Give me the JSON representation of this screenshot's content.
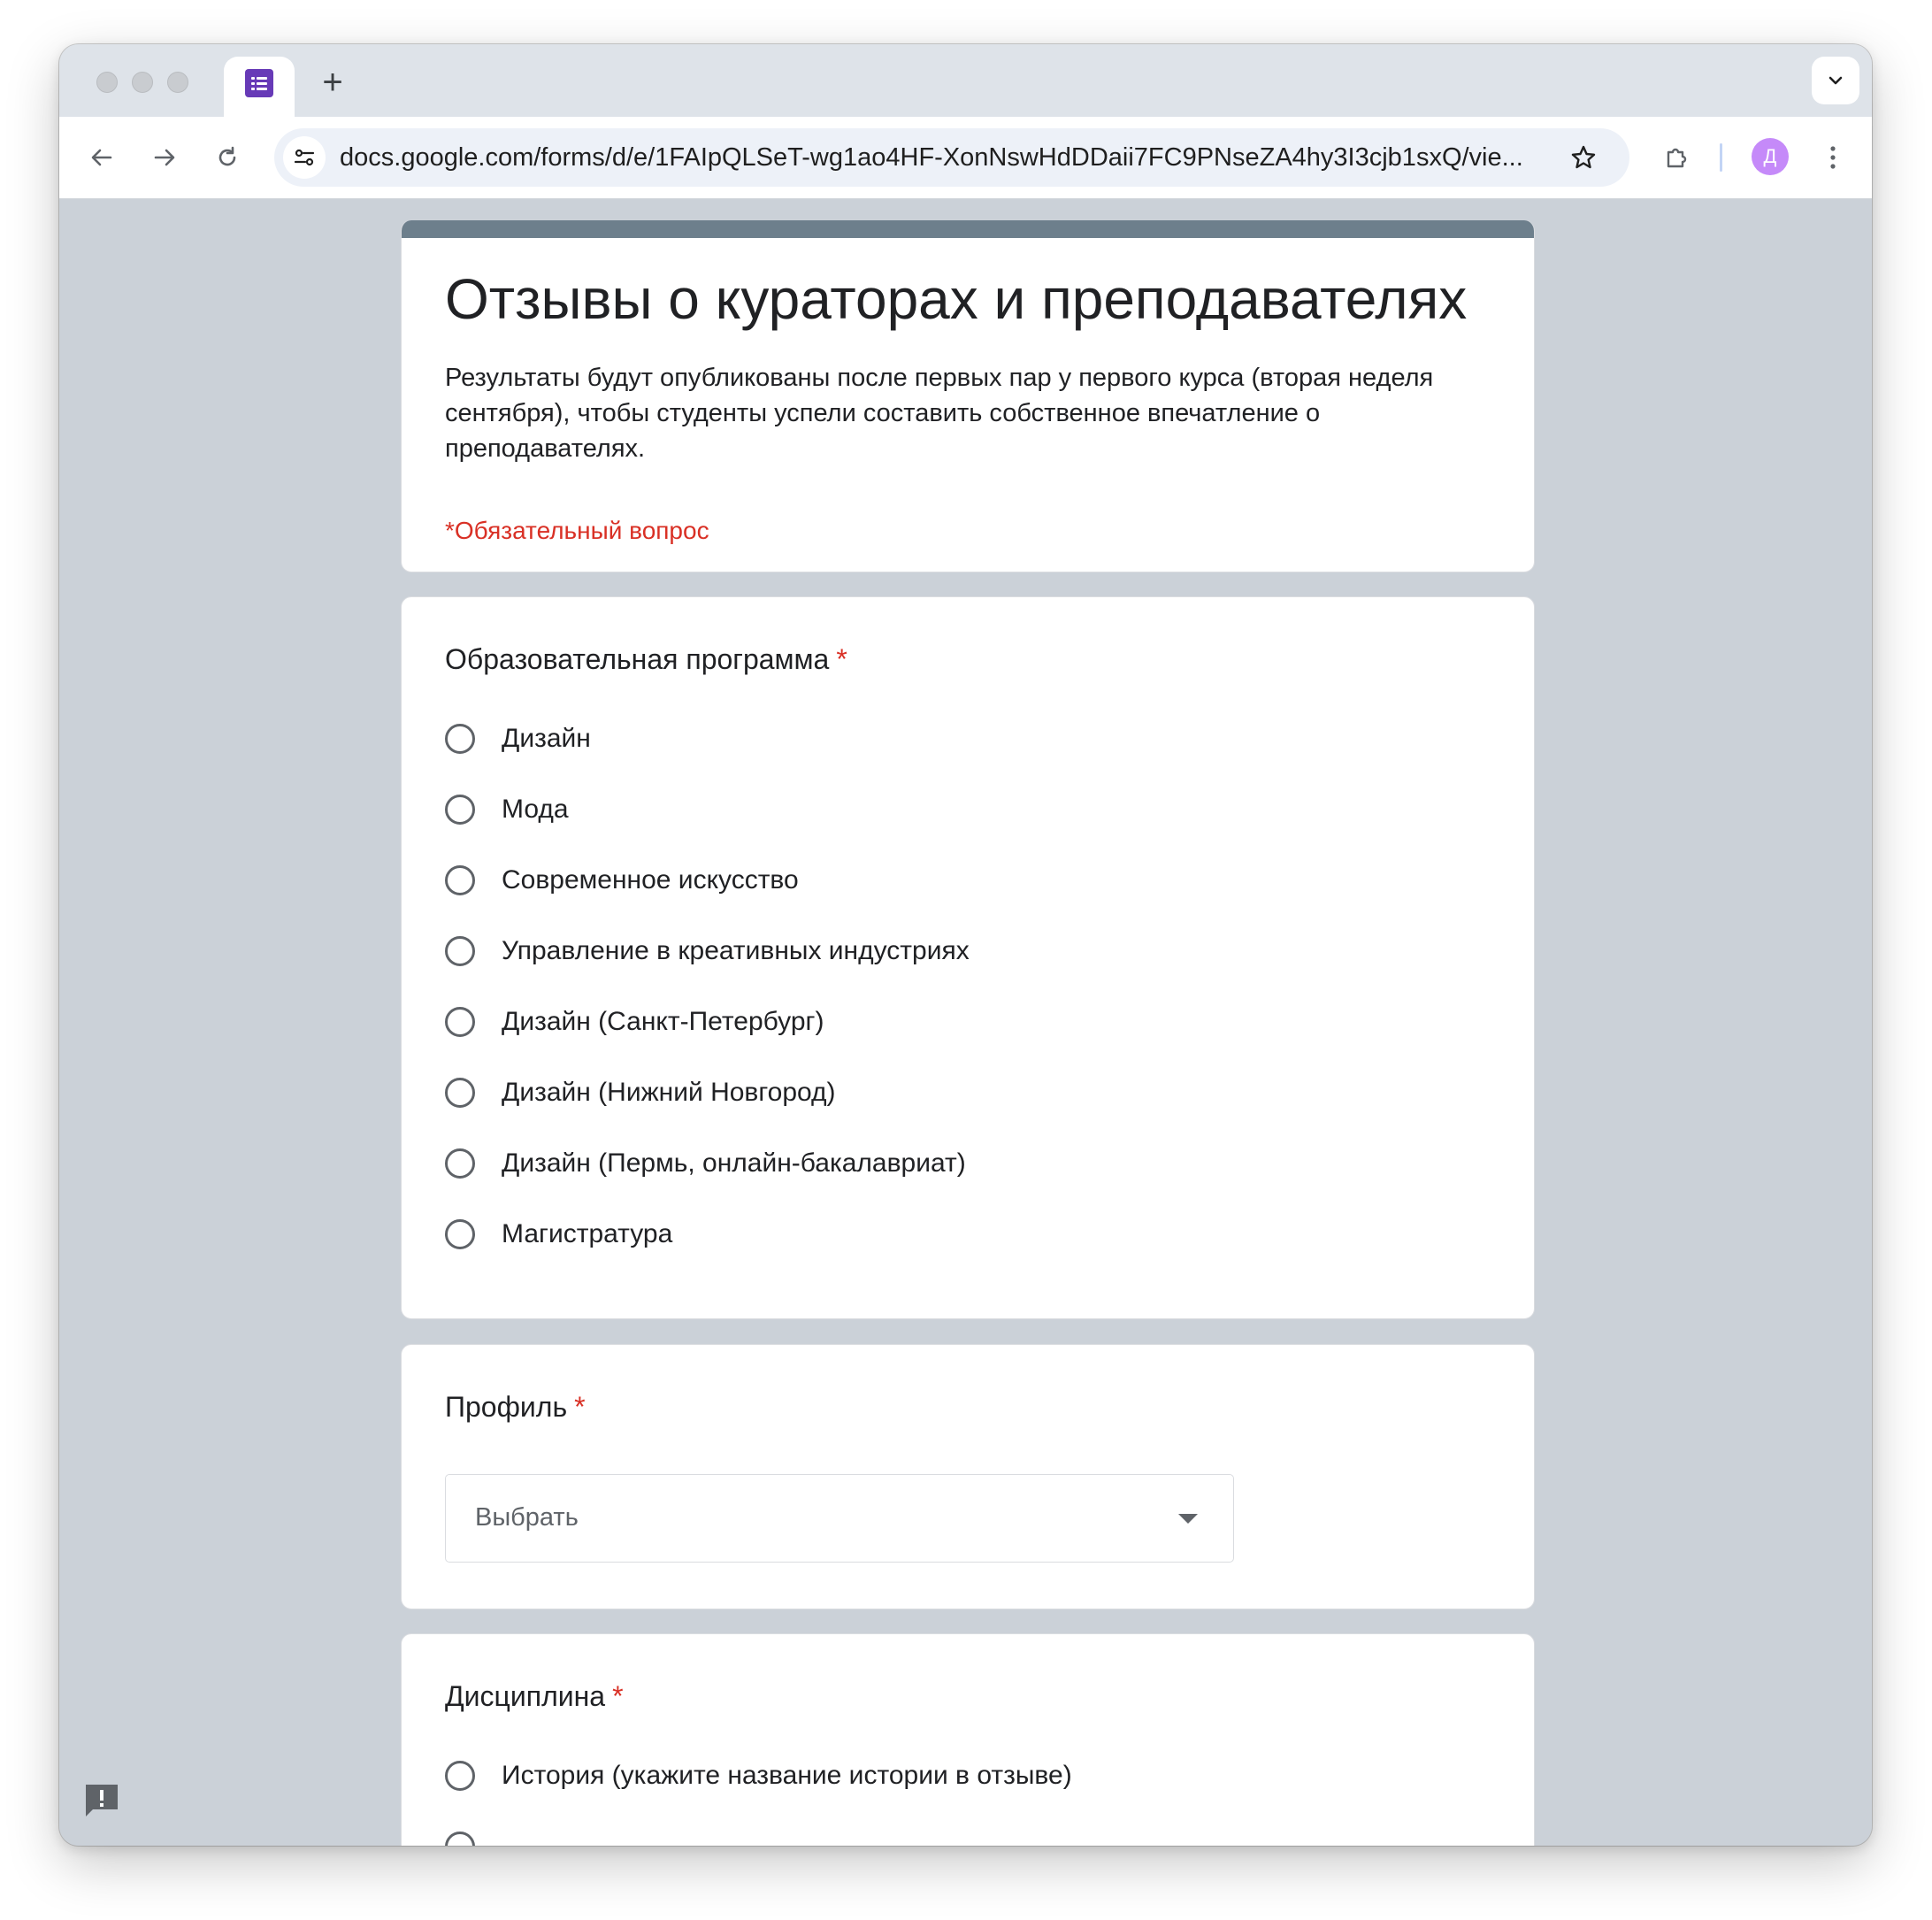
{
  "browser": {
    "url": "docs.google.com/forms/d/e/1FAIpQLSeT-wg1ao4HF-XonNswHdDDaii7FC9PNseZA4hy3I3cjb1sxQ/vie...",
    "profile_initial": "Д",
    "new_tab_label": "+",
    "tab_icon": "google-forms-icon"
  },
  "form": {
    "title": "Отзывы о кураторах и преподавателях",
    "description": "Результаты будут опубликованы после первых пар у первого курса (вторая неделя сентября), чтобы студенты успели составить собственное впечатление о преподавателях.",
    "required_note": "*Обязательный вопрос",
    "accent_color": "#6d7f8c",
    "required_color": "#d93025"
  },
  "questions": [
    {
      "title": "Образовательная программа",
      "required_mark": "*",
      "type": "radio",
      "options": [
        "Дизайн",
        "Мода",
        "Современное искусство",
        "Управление в креативных индустриях",
        "Дизайн (Санкт-Петербург)",
        "Дизайн (Нижний Новгород)",
        "Дизайн (Пермь, онлайн-бакалавриат)",
        "Магистратура"
      ]
    },
    {
      "title": "Профиль",
      "required_mark": "*",
      "type": "dropdown",
      "selected": "Выбрать"
    },
    {
      "title": "Дисциплина",
      "required_mark": "*",
      "type": "radio",
      "options": [
        "История (укажите название истории в отзыве)"
      ]
    }
  ]
}
